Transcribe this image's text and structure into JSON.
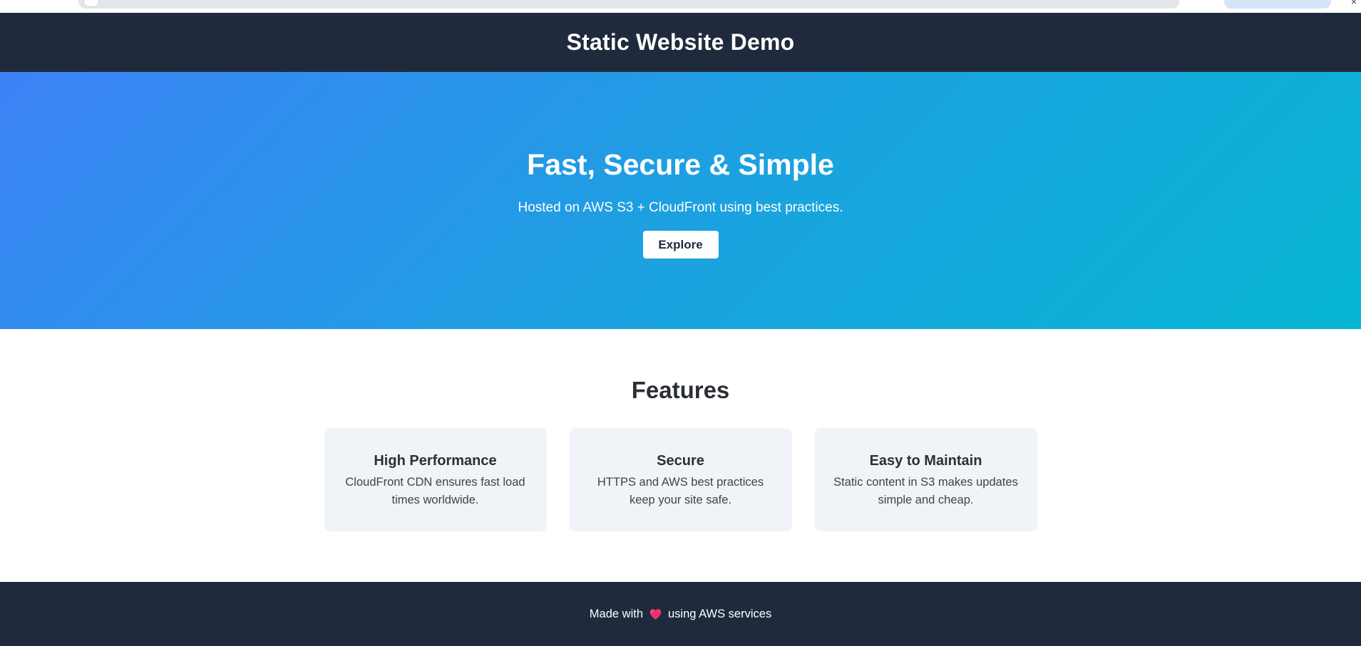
{
  "header": {
    "title": "Static Website Demo"
  },
  "hero": {
    "title": "Fast, Secure & Simple",
    "subtitle": "Hosted on AWS S3 + CloudFront using best practices.",
    "button_label": "Explore"
  },
  "features": {
    "title": "Features",
    "cards": [
      {
        "title": "High Performance",
        "text": "CloudFront CDN ensures fast load times worldwide."
      },
      {
        "title": "Secure",
        "text": "HTTPS and AWS best practices keep your site safe."
      },
      {
        "title": "Easy to Maintain",
        "text": "Static content in S3 makes updates simple and cheap."
      }
    ]
  },
  "footer": {
    "text_before": "Made with",
    "icon": "heart-icon",
    "text_after": "using AWS services"
  },
  "colors": {
    "header_bg": "#1f2a3c",
    "hero_gradient_start": "#3c82f6",
    "hero_gradient_end": "#07b6d4",
    "card_bg": "#f0f4f8",
    "heart": "#e8336f"
  }
}
